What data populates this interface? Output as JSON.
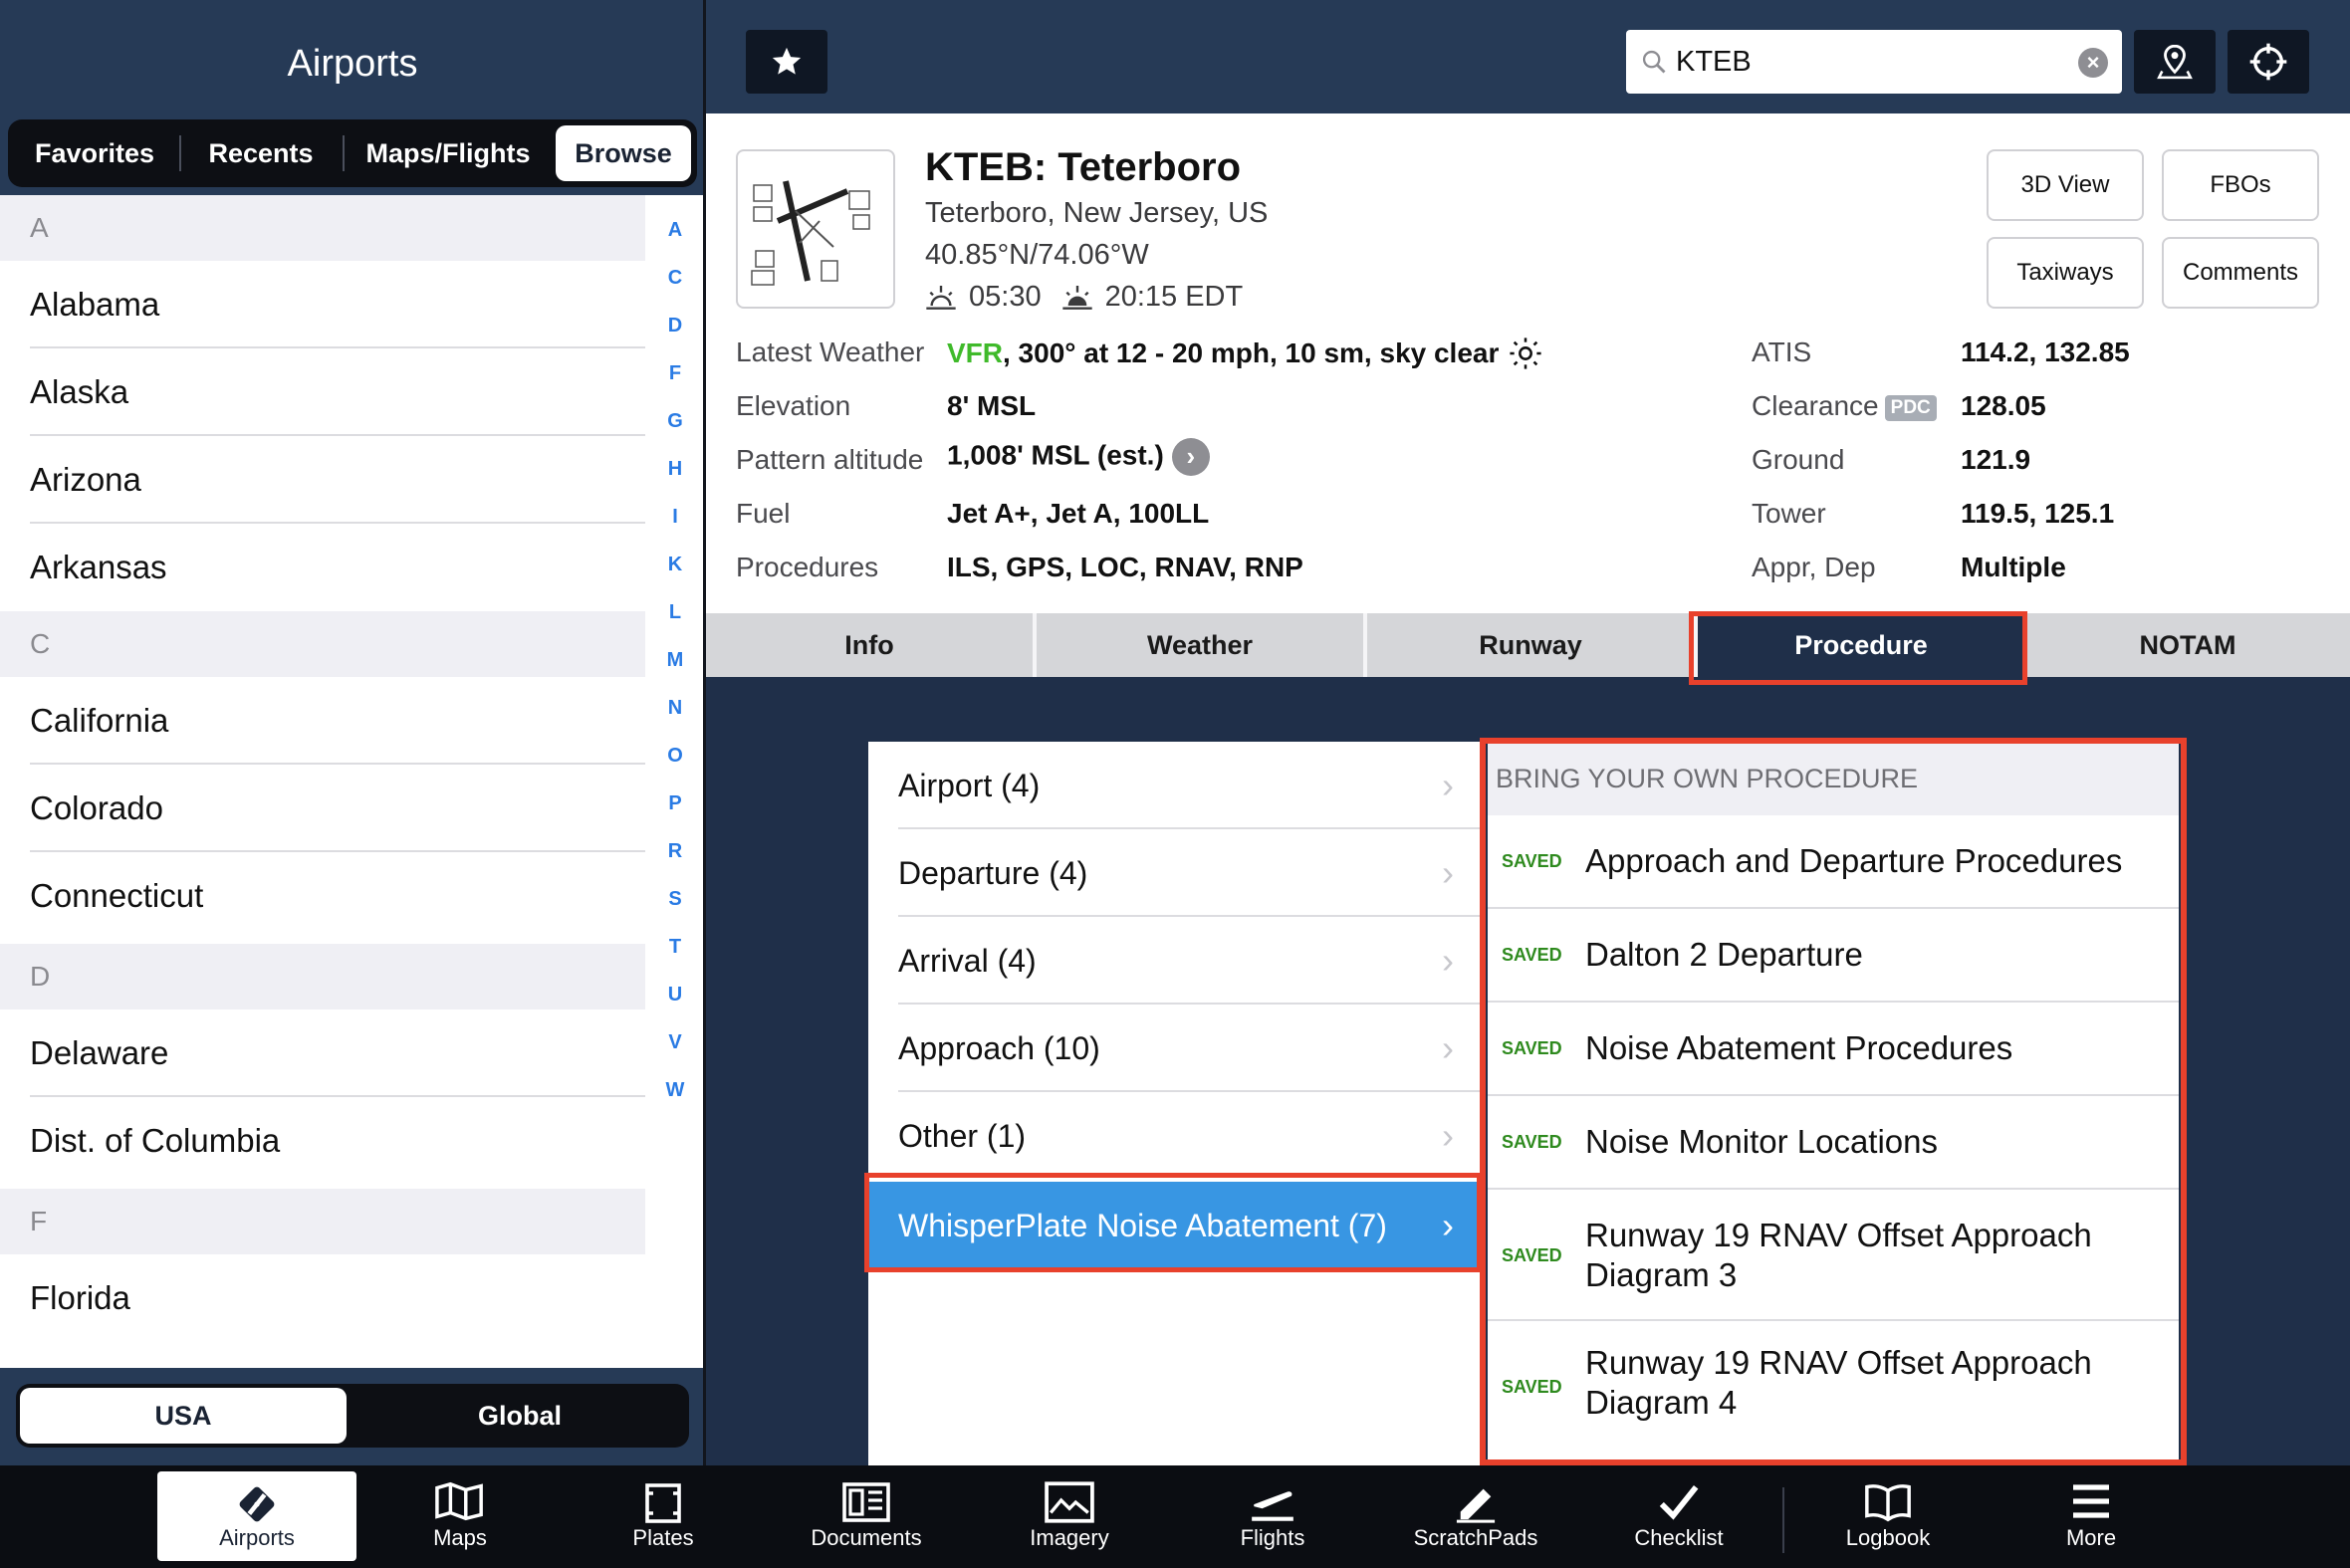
{
  "left_panel": {
    "title": "Airports",
    "segments": [
      "Favorites",
      "Recents",
      "Maps/Flights",
      "Browse"
    ],
    "selected_segment": "Browse",
    "sections": [
      {
        "header": "A",
        "items": [
          "Alabama",
          "Alaska",
          "Arizona",
          "Arkansas"
        ]
      },
      {
        "header": "C",
        "items": [
          "California",
          "Colorado",
          "Connecticut"
        ]
      },
      {
        "header": "D",
        "items": [
          "Delaware",
          "Dist. of Columbia"
        ]
      },
      {
        "header": "F",
        "items": [
          "Florida"
        ]
      }
    ],
    "alpha_index": [
      "A",
      "C",
      "D",
      "F",
      "G",
      "H",
      "I",
      "K",
      "L",
      "M",
      "N",
      "O",
      "P",
      "R",
      "S",
      "T",
      "U",
      "V",
      "W"
    ],
    "region_segments": [
      "USA",
      "Global"
    ],
    "selected_region": "USA"
  },
  "topbar": {
    "search": {
      "value": "KTEB"
    },
    "icons": [
      "star-icon",
      "map-pin-icon",
      "crosshair-icon"
    ]
  },
  "airport": {
    "title": "KTEB: Teterboro",
    "location": "Teterboro, New Jersey, US",
    "coordinates": "40.85°N/74.06°W",
    "sunrise": "05:30",
    "sunset": "20:15 EDT",
    "buttons": [
      "3D View",
      "FBOs",
      "Taxiways",
      "Comments"
    ],
    "weather_label": "Latest Weather",
    "weather_category": "VFR",
    "weather_rest": ", 300° at 12 - 20 mph, 10 sm, sky clear",
    "left_fields": [
      {
        "label": "Elevation",
        "value": "8' MSL"
      },
      {
        "label": "Pattern altitude",
        "value": "1,008' MSL (est.)"
      },
      {
        "label": "Fuel",
        "value": "Jet A+, Jet A, 100LL"
      },
      {
        "label": "Procedures",
        "value": "ILS, GPS, LOC, RNAV, RNP"
      }
    ],
    "right_fields": [
      {
        "label": "ATIS",
        "value": "114.2, 132.85"
      },
      {
        "label": "Clearance",
        "value": "128.05",
        "badge": "PDC"
      },
      {
        "label": "Ground",
        "value": "121.9"
      },
      {
        "label": "Tower",
        "value": "119.5, 125.1"
      },
      {
        "label": "Appr, Dep",
        "value": "Multiple"
      }
    ]
  },
  "tabs": [
    "Info",
    "Weather",
    "Runway",
    "Procedure",
    "NOTAM"
  ],
  "selected_tab": "Procedure",
  "procedure_categories": [
    {
      "label": "Airport (4)"
    },
    {
      "label": "Departure (4)"
    },
    {
      "label": "Arrival (4)"
    },
    {
      "label": "Approach (10)"
    },
    {
      "label": "Other (1)"
    },
    {
      "label": "WhisperPlate Noise Abatement (7)",
      "selected": true
    }
  ],
  "byop": {
    "header": "BRING YOUR OWN PROCEDURE",
    "saved_tag": "SAVED",
    "items": [
      [
        "Approach and Departure Procedures"
      ],
      [
        "Dalton 2 Departure"
      ],
      [
        "Noise Abatement Procedures"
      ],
      [
        "Noise Monitor Locations"
      ],
      [
        "Runway 19 RNAV Offset Approach",
        "Diagram 3"
      ],
      [
        "Runway 19 RNAV Offset Approach",
        "Diagram 4"
      ]
    ]
  },
  "bottom_tabs": [
    {
      "label": "Airports",
      "icon": "airports-icon",
      "selected": true
    },
    {
      "label": "Maps",
      "icon": "maps-icon"
    },
    {
      "label": "Plates",
      "icon": "plates-icon"
    },
    {
      "label": "Documents",
      "icon": "documents-icon"
    },
    {
      "label": "Imagery",
      "icon": "imagery-icon"
    },
    {
      "label": "Flights",
      "icon": "flights-icon"
    },
    {
      "label": "ScratchPads",
      "icon": "scratchpads-icon"
    },
    {
      "label": "Checklist",
      "icon": "checklist-icon"
    },
    {
      "label": "Logbook",
      "icon": "logbook-icon"
    },
    {
      "label": "More",
      "icon": "more-icon"
    }
  ],
  "colors": {
    "nav_bg": "#263a56",
    "accent_blue": "#3896e3",
    "highlight_red": "#e8412c",
    "vfr_green": "#3fba2a",
    "saved_green": "#2e8a1e"
  }
}
